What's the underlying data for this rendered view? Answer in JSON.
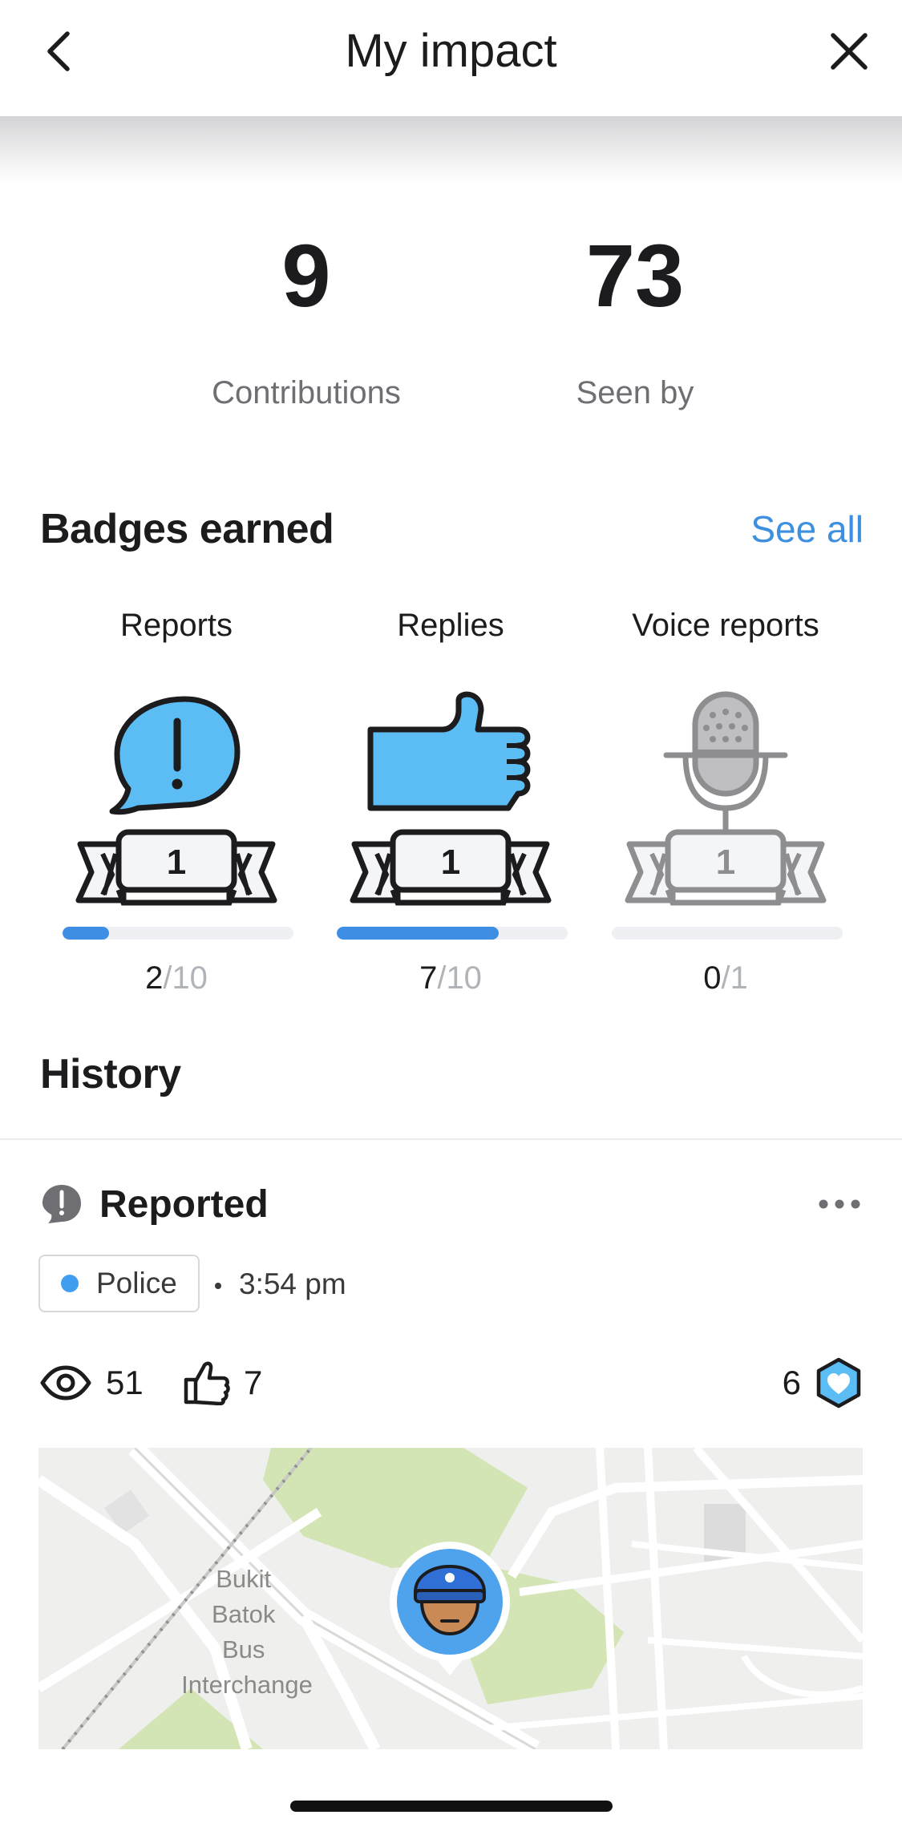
{
  "header": {
    "title": "My impact",
    "back_icon": "chevron-left-icon",
    "close_icon": "close-icon"
  },
  "stats": [
    {
      "value": "9",
      "label": "Contributions"
    },
    {
      "value": "73",
      "label": "Seen by"
    }
  ],
  "badges_section": {
    "title": "Badges earned",
    "see_all": "See all",
    "badges": [
      {
        "title": "Reports",
        "icon": "speech-bubble-exclamation-icon",
        "level": "1",
        "current": "2",
        "total": "10",
        "progress": 0.2
      },
      {
        "title": "Replies",
        "icon": "thumbs-up-icon",
        "level": "1",
        "current": "7",
        "total": "10",
        "progress": 0.7
      },
      {
        "title": "Voice reports",
        "icon": "microphone-icon",
        "level": "1",
        "current": "0",
        "total": "1",
        "progress": 0.0
      }
    ]
  },
  "history": {
    "title": "History",
    "items": [
      {
        "type_label": "Reported",
        "category": "Police",
        "category_color": "#3f9ef0",
        "time": "3:54 pm",
        "views": "51",
        "likes": "7",
        "score": "6",
        "map_label_lines": [
          "Bukit",
          "Batok",
          "Bus",
          "Interchange"
        ]
      }
    ]
  },
  "colors": {
    "accent": "#3d8fe0",
    "badge_blue": "#5bbdf4",
    "progress": "#3f8ee6"
  }
}
